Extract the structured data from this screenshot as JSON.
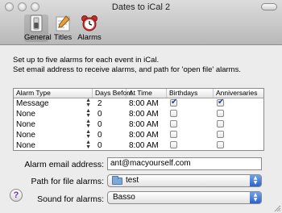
{
  "window": {
    "title": "Dates to iCal 2"
  },
  "toolbar": {
    "items": [
      {
        "label": "General",
        "icon": "switch-icon"
      },
      {
        "label": "Titles",
        "icon": "pencil-icon"
      },
      {
        "label": "Alarms",
        "icon": "alarm-clock-icon"
      }
    ]
  },
  "description": {
    "line1": "Set up to five alarms for each event in iCal.",
    "line2": "Set email address to receive alarms, and path for 'open file' alarms."
  },
  "table": {
    "headers": [
      "Alarm Type",
      "Days Before",
      "At Time",
      "Birthdays",
      "Anniversaries"
    ],
    "rows": [
      {
        "type": "Message",
        "days": "2",
        "time": "8:00 AM",
        "birthdays": true,
        "anniversaries": true
      },
      {
        "type": "None",
        "days": "0",
        "time": "8:00 AM",
        "birthdays": false,
        "anniversaries": false
      },
      {
        "type": "None",
        "days": "0",
        "time": "8:00 AM",
        "birthdays": false,
        "anniversaries": false
      },
      {
        "type": "None",
        "days": "0",
        "time": "8:00 AM",
        "birthdays": false,
        "anniversaries": false
      },
      {
        "type": "None",
        "days": "0",
        "time": "8:00 AM",
        "birthdays": false,
        "anniversaries": false
      }
    ]
  },
  "form": {
    "email_label": "Alarm email address:",
    "email_value": "ant@macyourself.com",
    "path_label": "Path for file alarms:",
    "path_value": "test",
    "sound_label": "Sound for alarms:",
    "sound_value": "Basso"
  },
  "help": {
    "glyph": "?"
  },
  "colors": {
    "accent": "#2c62c9",
    "check": "#1b3e9a"
  }
}
